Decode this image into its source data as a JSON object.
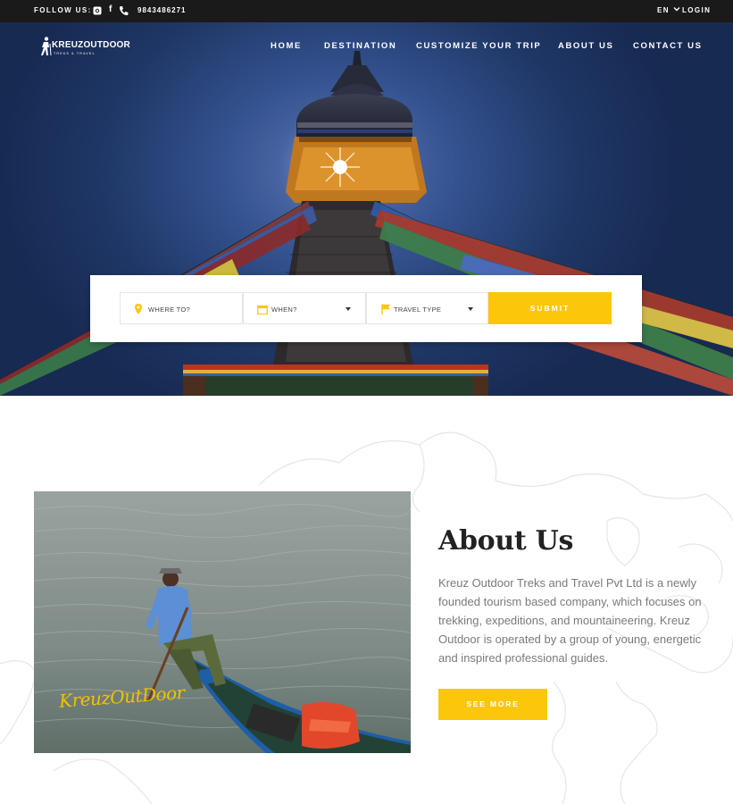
{
  "topbar": {
    "follow_label": "FOLLOW US:",
    "social_icons": [
      "instagram-icon",
      "facebook-icon",
      "phone-icon"
    ],
    "facebook_glyph": "f",
    "phone": "9843486271",
    "language": "EN",
    "login": "LOGIN"
  },
  "logo": {
    "brand": "KREUZOUTDOOR",
    "tagline": "TREKS & TRAVEL"
  },
  "nav": {
    "items": [
      "HOME",
      "DESTINATION",
      "CUSTOMIZE YOUR TRIP",
      "ABOUT US",
      "CONTACT US"
    ]
  },
  "search": {
    "where_label": "WHERE TO?",
    "when_label": "WHEN?",
    "type_label": "TRAVEL TYPE",
    "submit_label": "SUBMIT"
  },
  "about": {
    "title": "About Us",
    "text": "Kreuz Outdoor Treks and Travel Pvt Ltd is a newly founded tourism based company, which focuses on trekking, expeditions, and mountaineering. Kreuz Outdoor is operated by a group of young, energetic and inspired professional guides.",
    "button": "SEE MORE",
    "photo_watermark": "KreuzOutDoor"
  },
  "colors": {
    "accent": "#fcc70a",
    "topbar": "#1a1a1a",
    "sky": "#2a4478",
    "text_muted": "#7a7a7a",
    "heading": "#222222"
  }
}
